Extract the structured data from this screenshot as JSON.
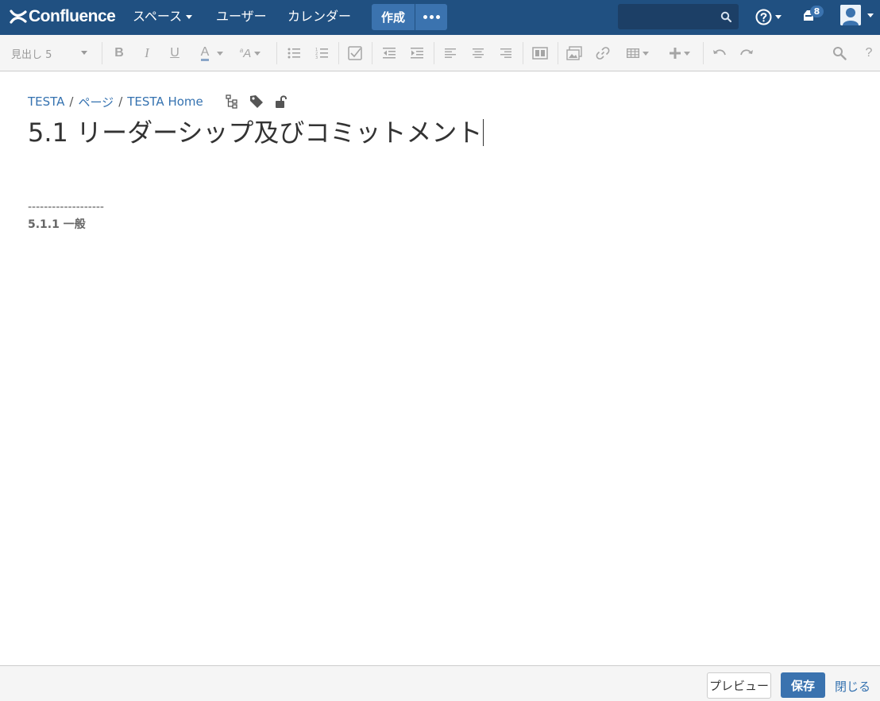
{
  "app": {
    "logo_text": "Confluence"
  },
  "topnav": {
    "spaces_label": "スペース",
    "users_label": "ユーザー",
    "calendar_label": "カレンダー",
    "create_label": "作成",
    "search_placeholder": "",
    "notification_count": "8"
  },
  "toolbar": {
    "heading_select": "見出し 5",
    "buttons": [
      "bold-icon",
      "italic-icon",
      "underline-icon",
      "text-color-icon",
      "text-size-icon",
      "bullet-list-icon",
      "numbered-list-icon",
      "task-list-icon",
      "outdent-icon",
      "indent-icon",
      "align-left-icon",
      "align-center-icon",
      "align-right-icon",
      "page-layout-icon",
      "insert-image-icon",
      "insert-link-icon",
      "insert-table-icon",
      "insert-more-icon",
      "undo-icon",
      "redo-icon",
      "find-replace-icon",
      "help-icon"
    ]
  },
  "breadcrumb": {
    "items": [
      "TESTA",
      "ページ",
      "TESTA Home"
    ]
  },
  "page": {
    "title": "5.1 リーダーシップ及びコミットメント",
    "divider_text": "-------------------",
    "section_heading": "5.1.1 一般"
  },
  "footer": {
    "preview_label": "プレビュー",
    "save_label": "保存",
    "close_label": "閉じる"
  },
  "colors": {
    "nav_bg": "#205081",
    "accent": "#3b73af",
    "link": "#3572b0"
  }
}
